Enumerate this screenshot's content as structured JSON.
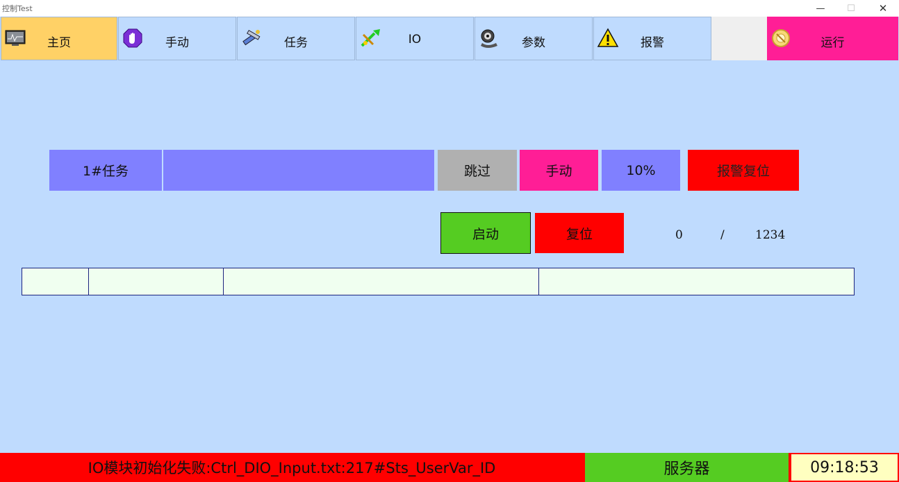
{
  "window": {
    "title": "控制Test",
    "minimize": "—",
    "maximize": "☐",
    "close": "✕"
  },
  "nav": {
    "tabs": [
      {
        "label": "主页",
        "icon": "monitor-icon"
      },
      {
        "label": "手动",
        "icon": "hand-icon"
      },
      {
        "label": "任务",
        "icon": "tools-icon"
      },
      {
        "label": "IO",
        "icon": "io-icon"
      },
      {
        "label": "参数",
        "icon": "camera-icon"
      },
      {
        "label": "报警",
        "icon": "warning-icon"
      }
    ],
    "run": {
      "label": "运行",
      "icon": "gear-icon"
    }
  },
  "task": {
    "label": "1#任务",
    "skip": "跳过",
    "manual": "手动",
    "percent": "10%",
    "alarm_reset": "报警复位"
  },
  "control": {
    "start": "启动",
    "reset": "复位",
    "current": "0",
    "separator": "/",
    "total": "1234"
  },
  "status": {
    "message": "IO模块初始化失败:Ctrl_DIO_Input.txt:217#Sts_UserVar_ID",
    "server": "服务器",
    "time": "09:18:53"
  },
  "colors": {
    "background": "#bfdbfe",
    "home_tab": "#ffd166",
    "run": "#ff1e96",
    "task": "#8080ff",
    "alarm": "#ff0000",
    "ok": "#55cc22",
    "clock_bg": "#ffffc0"
  }
}
